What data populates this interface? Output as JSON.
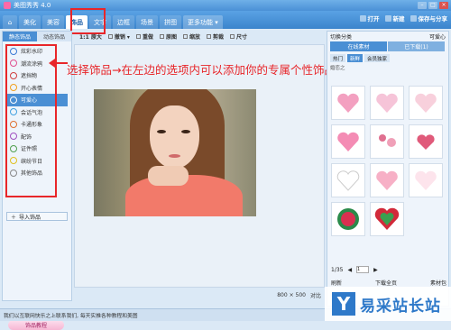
{
  "window": {
    "title": "美图秀秀 4.0"
  },
  "menu": {
    "tabs": [
      "美化",
      "美容",
      "饰品",
      "文字",
      "边框",
      "场景",
      "拼图",
      "更多功能 ▾"
    ]
  },
  "topright": {
    "open": "打开",
    "new": "新建",
    "save": "保存与分享"
  },
  "left": {
    "tabs": [
      "静态饰品",
      "动态饰品"
    ],
    "categories": [
      "炫彩水印",
      "潮流涂鸦",
      "遮挡物",
      "开心表情",
      "可爱心",
      "会话气泡",
      "卡通形象",
      "配饰",
      "证件照",
      "缤纷节日",
      "其他饰品"
    ],
    "import_label": "导入饰品",
    "tutorial_label": "饰品教程"
  },
  "toolbar": {
    "items": [
      "1:1 原大",
      "撤销 ▾",
      "重做",
      "原图",
      "缩放",
      "剪裁",
      "尺寸"
    ]
  },
  "callout": "选择饰品→在左边的选项内可以添加你的专属个性饰品",
  "bottom": {
    "size": "800 × 500",
    "compare": "对比"
  },
  "status": "我们以互联网快乐之上联系我们, 每天实推各种教程和美图",
  "right": {
    "row1_left": "切换分类",
    "row1_right": "可爱心",
    "tabs": [
      "在线素材",
      "已下载(1)"
    ],
    "subtabs": [
      "热门",
      "新鲜",
      "会员独家"
    ],
    "subtags": [
      "婚恋之"
    ],
    "pager": "1/35",
    "pager_input": "1",
    "actions": [
      "刷新",
      "下载全页",
      "素材包"
    ]
  },
  "watermark": {
    "logo": "Y",
    "text": "易采站长站"
  },
  "colors": {
    "accent": "#4a8fd4",
    "highlight": "#e8262a"
  }
}
